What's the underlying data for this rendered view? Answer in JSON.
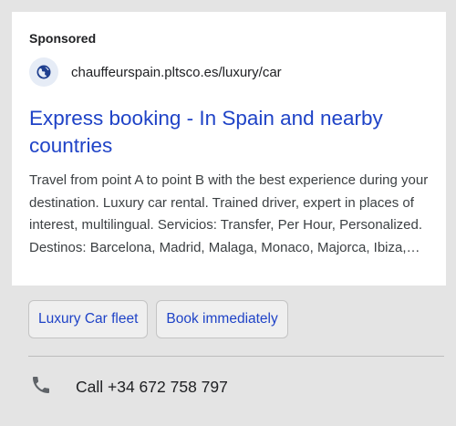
{
  "ad": {
    "sponsored_label": "Sponsored",
    "display_url": "chauffeurspain.pltsco.es/luxury/car",
    "site_icon": "globe-icon",
    "headline": "Express booking - In Spain and nearby countries",
    "description": "Travel from point A to point B with the best experience during your destination. Luxury car rental. Trained driver, expert in places of interest, multilingual. Servicios: Transfer, Per Hour, Personalized. Destinos: Barcelona, Madrid, Malaga, Monaco, Majorca, Ibiza,…"
  },
  "sitelinks": [
    {
      "label": "Luxury Car fleet"
    },
    {
      "label": "Book immediately"
    }
  ],
  "call": {
    "icon": "phone-icon",
    "label": "Call +34 672 758 797"
  },
  "colors": {
    "link": "#1f43c7",
    "panel_bg": "#e4e4e4",
    "card_bg": "#ffffff"
  }
}
